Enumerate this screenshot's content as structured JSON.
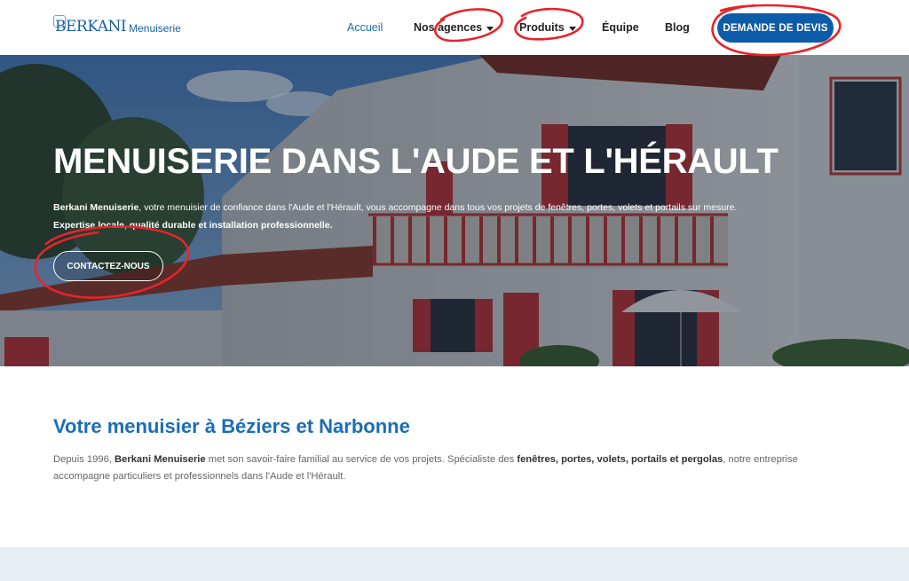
{
  "header": {
    "logo_main": "BERKANI",
    "logo_sub": "Menuiserie",
    "nav": [
      {
        "label": "Accueil",
        "active": true
      },
      {
        "label": "Nos agences",
        "dropdown": true
      },
      {
        "label": "Produits",
        "dropdown": true
      },
      {
        "label": "Équipe"
      },
      {
        "label": "Blog"
      }
    ],
    "cta_label": "DEMANDE DE DEVIS"
  },
  "hero": {
    "title": "MENUISERIE DANS L'AUDE ET L'HÉRAULT",
    "brand": "Berkani Menuiserie",
    "text": ", votre menuisier de confiance dans l'Aude et l'Hérault, vous accompagne dans tous vos projets de fenêtres, portes, volets et portails sur mesure.",
    "text_line2": "Expertise locale, qualité durable et installation professionnelle.",
    "button_label": "CONTACTEZ-NOUS"
  },
  "intro": {
    "title": "Votre menuisier à Béziers et Narbonne",
    "p_start": "Depuis 1996, ",
    "p_brand": "Berkani Menuiserie",
    "p_mid": " met son savoir-faire familial au service de vos projets. Spécialiste des ",
    "p_products": "fenêtres, portes, volets, portails et pergolas",
    "p_end": ", notre entreprise accompagne particuliers et professionnels dans l'Aude et l'Hérault."
  },
  "colors": {
    "brand_blue": "#1b6db5",
    "cta_blue": "#0d5ca8",
    "annotation_red": "#e8232a"
  }
}
